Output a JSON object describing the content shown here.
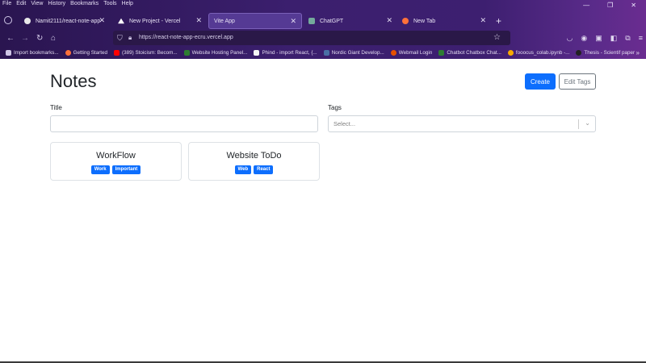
{
  "menubar": {
    "items": [
      "File",
      "Edit",
      "View",
      "History",
      "Bookmarks",
      "Tools",
      "Help"
    ]
  },
  "tabs": [
    {
      "label": "Namit2111/react-note-app",
      "icon": "github-icon",
      "color": "#1a1a1a",
      "active": false
    },
    {
      "label": "New Project - Vercel",
      "icon": "vercel-icon",
      "color": "#000000",
      "active": false
    },
    {
      "label": "Vite App",
      "icon": "",
      "color": "",
      "active": true
    },
    {
      "label": "ChatGPT",
      "icon": "chatgpt-icon",
      "color": "#74aa9c",
      "active": false
    },
    {
      "label": "New Tab",
      "icon": "firefox-icon",
      "color": "#ff7139",
      "active": false
    }
  ],
  "address_bar": {
    "url": "https://react-note-app-ecru.vercel.app"
  },
  "bookmarks": [
    {
      "label": "Import bookmarks...",
      "icon": "import-icon",
      "color": "#cfc6e6"
    },
    {
      "label": "Getting Started",
      "icon": "firefox-icon",
      "color": "#ff7139"
    },
    {
      "label": "(389) Stoicism: Becom...",
      "icon": "youtube-icon",
      "color": "#ff0000"
    },
    {
      "label": "Website Hosting Panel...",
      "icon": "hosting-icon",
      "color": "#2e7d32"
    },
    {
      "label": "Phind - import React, {...",
      "icon": "phind-icon",
      "color": "#111111"
    },
    {
      "label": "Nordic Giant Develop...",
      "icon": "nordic-icon",
      "color": "#4a6fa5"
    },
    {
      "label": "Webmail Login",
      "icon": "webmail-icon",
      "color": "#e65100"
    },
    {
      "label": "Chatbot Chatbox Chat...",
      "icon": "chatbot-icon",
      "color": "#2e7d32"
    },
    {
      "label": "fooocus_colab.ipynb -...",
      "icon": "colab-icon",
      "color": "#f9ab00"
    },
    {
      "label": "Thesis - Scientif paper",
      "icon": "thesis-icon",
      "color": "#222222"
    }
  ],
  "page": {
    "title": "Notes",
    "create_label": "Create",
    "edit_tags_label": "Edit Tags",
    "title_label": "Title",
    "tags_label": "Tags",
    "title_value": "",
    "tags_placeholder": "Select..."
  },
  "notes": [
    {
      "title": "WorkFlow",
      "tags": [
        "Work",
        "Important"
      ]
    },
    {
      "title": "Website ToDo",
      "tags": [
        "Web",
        "React"
      ]
    }
  ],
  "colors": {
    "primary": "#0d6efd",
    "secondary": "#6c757d"
  }
}
